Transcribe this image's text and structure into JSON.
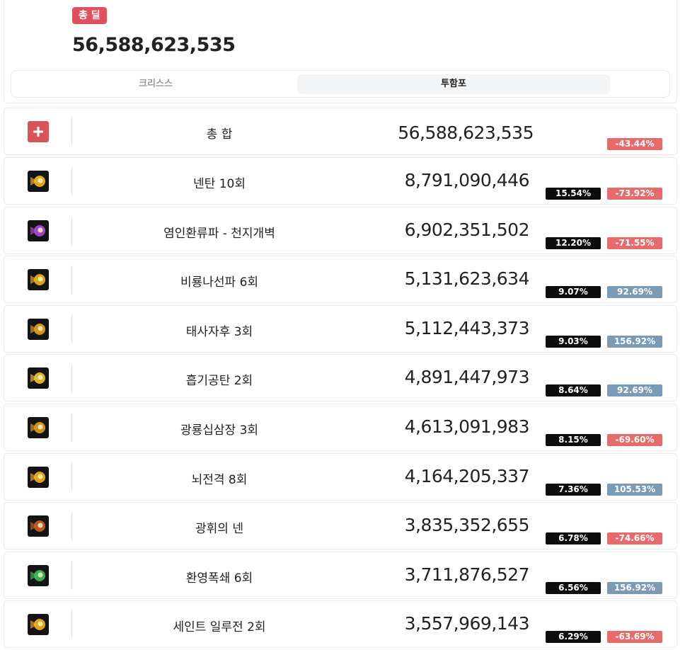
{
  "summary": {
    "badge": "총 딜",
    "total": "56,588,623,535"
  },
  "tabs": [
    {
      "label": "크리스스",
      "active": false
    },
    {
      "label": "투함포",
      "active": true
    }
  ],
  "total_row": {
    "name": "총 합",
    "damage": "56,588,623,535",
    "change": "-43.44%",
    "change_sign": "neg"
  },
  "skills": [
    {
      "name": "넨탄 10회",
      "damage": "8,791,090,446",
      "share": "15.54%",
      "change": "-73.92%",
      "change_sign": "neg",
      "icon": "nen-shot-icon",
      "icon_color": "#f5b820"
    },
    {
      "name": "염인환류파 - 천지개벽",
      "damage": "6,902,351,502",
      "share": "12.20%",
      "change": "-71.55%",
      "change_sign": "neg",
      "icon": "flame-wave-icon",
      "icon_color": "#b04bd6"
    },
    {
      "name": "비룡나선파 6회",
      "damage": "5,131,623,634",
      "share": "9.07%",
      "change": "92.69%",
      "change_sign": "pos",
      "icon": "dragon-spiral-icon",
      "icon_color": "#f0b319"
    },
    {
      "name": "태사자후 3회",
      "damage": "5,112,443,373",
      "share": "9.03%",
      "change": "156.92%",
      "change_sign": "pos",
      "icon": "lion-roar-icon",
      "icon_color": "#e8a21c"
    },
    {
      "name": "흡기공탄 2회",
      "damage": "4,891,447,973",
      "share": "8.64%",
      "change": "92.69%",
      "change_sign": "pos",
      "icon": "absorb-shot-icon",
      "icon_color": "#f1c232"
    },
    {
      "name": "광룡십삼장 3회",
      "damage": "4,613,091,983",
      "share": "8.15%",
      "change": "-69.60%",
      "change_sign": "neg",
      "icon": "mad-dragon-icon",
      "icon_color": "#e39f1a"
    },
    {
      "name": "뇌전격 8회",
      "damage": "4,164,205,337",
      "share": "7.36%",
      "change": "105.53%",
      "change_sign": "pos",
      "icon": "thunder-strike-icon",
      "icon_color": "#f4b41a"
    },
    {
      "name": "광휘의 넨",
      "damage": "3,835,352,655",
      "share": "6.78%",
      "change": "-74.66%",
      "change_sign": "neg",
      "icon": "radiant-nen-icon",
      "icon_color": "#c9621f"
    },
    {
      "name": "환영폭쇄 6회",
      "damage": "3,711,876,527",
      "share": "6.56%",
      "change": "156.92%",
      "change_sign": "pos",
      "icon": "phantom-burst-icon",
      "icon_color": "#3fbf5a"
    },
    {
      "name": "세인트 일루전 2회",
      "damage": "3,557,969,143",
      "share": "6.29%",
      "change": "-63.69%",
      "change_sign": "neg",
      "icon": "saint-illusion-icon",
      "icon_color": "#efb21b"
    }
  ]
}
